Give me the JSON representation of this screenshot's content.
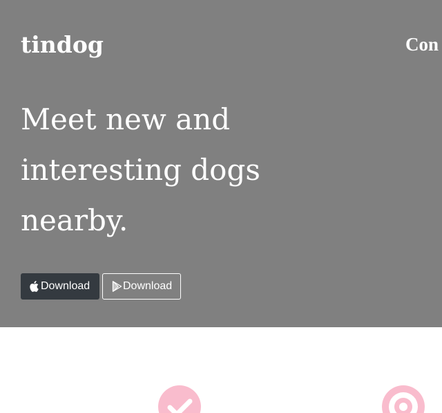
{
  "navbar": {
    "brand": "tindog",
    "link": "Con"
  },
  "hero": {
    "headline": "Meet new and interesting dogs nearby.",
    "buttons": [
      {
        "label": "Download",
        "icon": "apple-icon"
      },
      {
        "label": "Download",
        "icon": "google-play-icon"
      }
    ]
  },
  "features": {
    "icons": [
      "check-circle-icon",
      "bullseye-icon"
    ]
  },
  "colors": {
    "hero_bg": "#808080",
    "dark_button": "#343a40",
    "accent_pink": "#f9bccd",
    "text": "#ffffff"
  }
}
